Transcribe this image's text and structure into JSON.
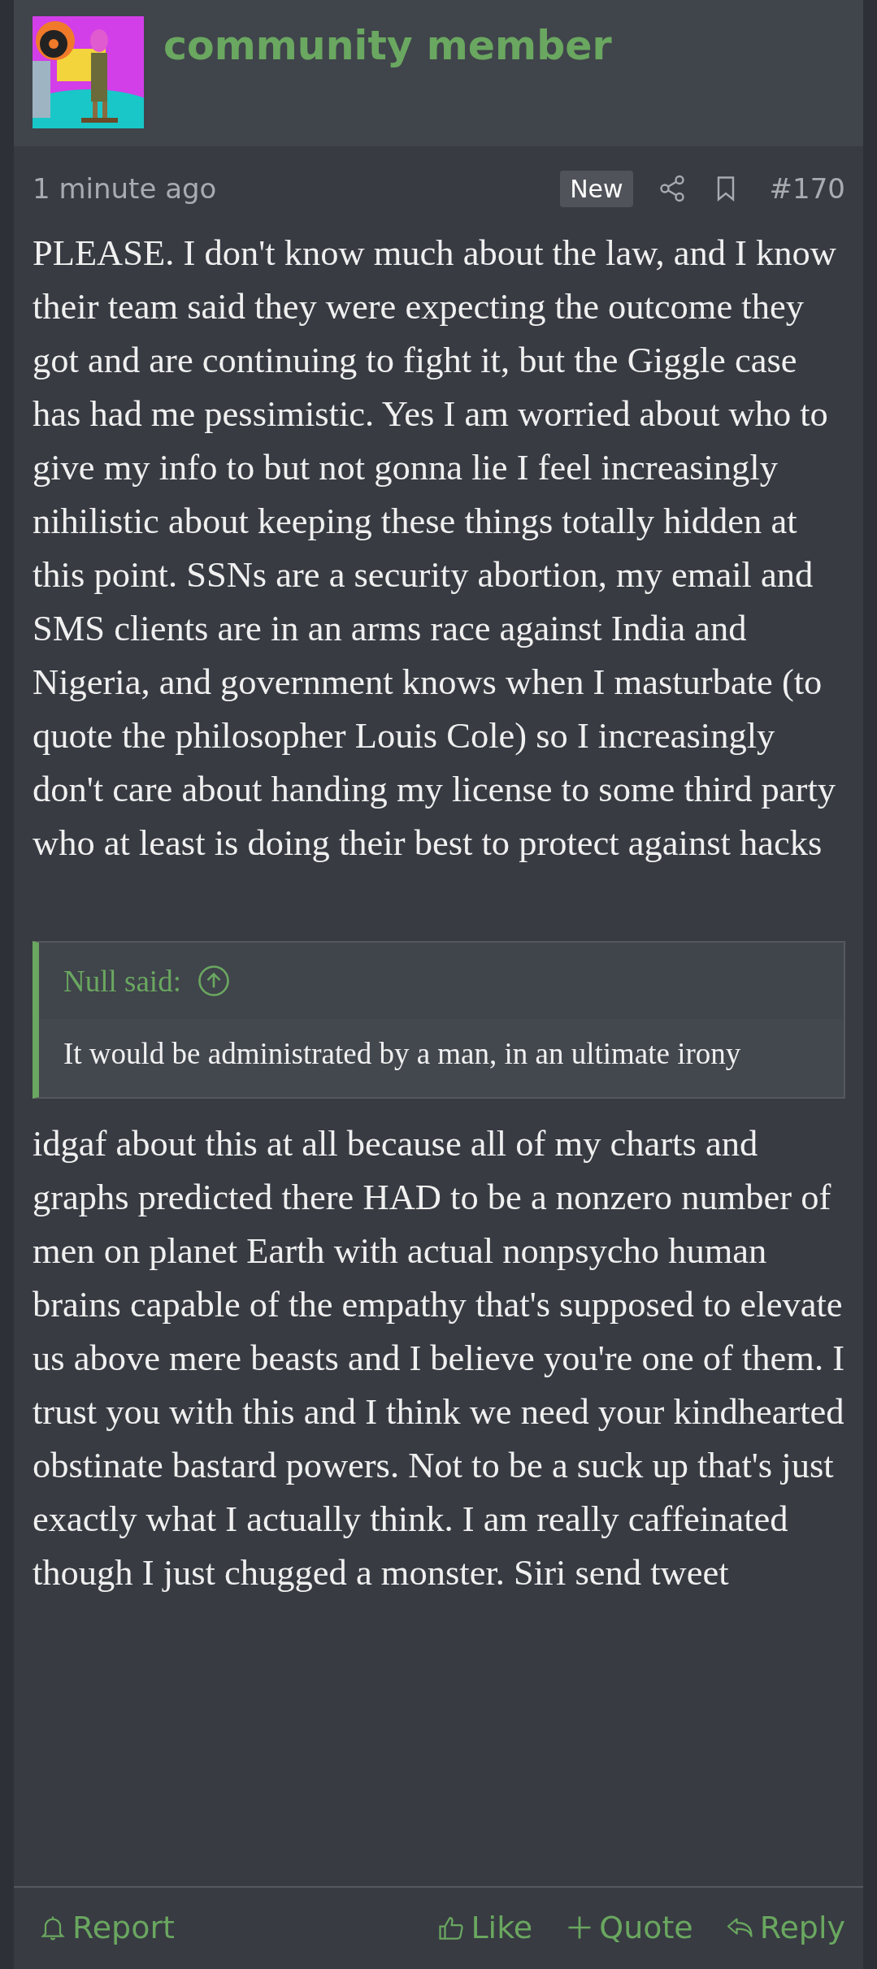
{
  "author": {
    "name": "community member"
  },
  "meta": {
    "time": "1 minute ago",
    "badge": "New",
    "post_number": "#170"
  },
  "paragraphs": [
    "PLEASE. I don't know much about the law, and I know their team said they were expecting the outcome they got and are continuing to fight it, but the Giggle case has had me pessimistic. Yes I am worried about who to give my info to but not gonna lie I feel increasingly nihilistic about keeping these things totally hidden at this point. SSNs are a security abortion, my email and SMS clients are in an arms race against India and Nigeria, and government knows when I masturbate (to quote the philosopher Louis Cole) so I increasingly don't care about handing my license to some third party who at least is doing their best to protect against hacks"
  ],
  "quote": {
    "attribution": "Null said:",
    "text": "It would be administrated by a man, in an ultimate irony"
  },
  "paragraphs_after": [
    "idgaf about this at all because all of my charts and graphs predicted there HAD to be a nonzero number of men on planet Earth with actual nonpsycho human brains capable of the empathy that's supposed to elevate us above mere beasts and I believe you're one of them. I trust you with this and I think we need your kindhearted obstinate bastard powers. Not to be a suck up that's just exactly what I actually think. I am really caffeinated though I just chugged a monster. Siri send tweet"
  ],
  "actions": [
    {
      "kind": "report",
      "label": "Report"
    },
    {
      "kind": "like",
      "label": "Like"
    },
    {
      "kind": "quote",
      "label": "Quote"
    },
    {
      "kind": "reply",
      "label": "Reply"
    }
  ]
}
